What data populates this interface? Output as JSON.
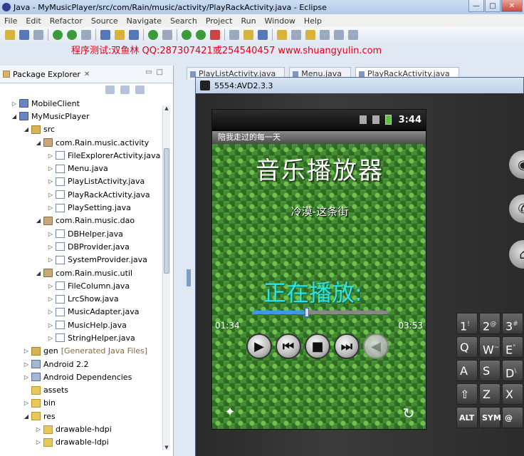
{
  "window": {
    "title": "Java - MyMusicPlayer/src/com/Rain/music/activity/PlayRackActivity.java - Eclipse",
    "min": "—",
    "max": "□",
    "close": "✕"
  },
  "menu": [
    "File",
    "Edit",
    "Refactor",
    "Source",
    "Navigate",
    "Search",
    "Project",
    "Run",
    "Window",
    "Help"
  ],
  "overlay_text": "程序测试:双鱼林 QQ:287307421或254540457 www.shuangyulin.com",
  "package_explorer": {
    "tab_label": "Package Explorer",
    "close": "✕",
    "tree": [
      {
        "label": "MobileClient",
        "level": 1,
        "icon": "project-icon",
        "twisty": "▷"
      },
      {
        "label": "MyMusicPlayer",
        "level": 1,
        "icon": "project-icon",
        "twisty": "◢"
      },
      {
        "label": "src",
        "level": 2,
        "icon": "source-folder-icon",
        "twisty": "◢"
      },
      {
        "label": "com.Rain.music.activity",
        "level": 3,
        "icon": "package-icon",
        "twisty": "◢"
      },
      {
        "label": "FileExplorerActivity.java",
        "level": 4,
        "icon": "java-file-icon",
        "twisty": "▷"
      },
      {
        "label": "Menu.java",
        "level": 4,
        "icon": "java-file-icon",
        "twisty": "▷"
      },
      {
        "label": "PlayListActivity.java",
        "level": 4,
        "icon": "java-file-icon",
        "twisty": "▷"
      },
      {
        "label": "PlayRackActivity.java",
        "level": 4,
        "icon": "java-file-icon",
        "twisty": "▷"
      },
      {
        "label": "PlaySetting.java",
        "level": 4,
        "icon": "java-file-icon",
        "twisty": "▷"
      },
      {
        "label": "com.Rain.music.dao",
        "level": 3,
        "icon": "package-icon",
        "twisty": "◢"
      },
      {
        "label": "DBHelper.java",
        "level": 4,
        "icon": "java-file-icon",
        "twisty": "▷"
      },
      {
        "label": "DBProvider.java",
        "level": 4,
        "icon": "java-file-icon",
        "twisty": "▷"
      },
      {
        "label": "SystemProvider.java",
        "level": 4,
        "icon": "java-file-icon",
        "twisty": "▷"
      },
      {
        "label": "com.Rain.music.util",
        "level": 3,
        "icon": "package-icon",
        "twisty": "◢"
      },
      {
        "label": "FileColumn.java",
        "level": 4,
        "icon": "java-file-icon",
        "twisty": "▷"
      },
      {
        "label": "LrcShow.java",
        "level": 4,
        "icon": "java-file-icon",
        "twisty": "▷"
      },
      {
        "label": "MusicAdapter.java",
        "level": 4,
        "icon": "java-file-icon",
        "twisty": "▷"
      },
      {
        "label": "MusicHelp.java",
        "level": 4,
        "icon": "java-file-icon",
        "twisty": "▷"
      },
      {
        "label": "StringHelper.java",
        "level": 4,
        "icon": "java-file-icon",
        "twisty": "▷"
      },
      {
        "label": "gen",
        "level": 2,
        "icon": "source-folder-icon",
        "twisty": "▷",
        "decoration": "[Generated Java Files]"
      },
      {
        "label": "Android 2.2",
        "level": 2,
        "icon": "library-icon",
        "twisty": "▷"
      },
      {
        "label": "Android Dependencies",
        "level": 2,
        "icon": "library-icon",
        "twisty": "▷"
      },
      {
        "label": "assets",
        "level": 2,
        "icon": "folder-icon",
        "twisty": ""
      },
      {
        "label": "bin",
        "level": 2,
        "icon": "folder-icon",
        "twisty": "▷"
      },
      {
        "label": "res",
        "level": 2,
        "icon": "folder-icon",
        "twisty": "◢"
      },
      {
        "label": "drawable-hdpi",
        "level": 3,
        "icon": "folder-icon",
        "twisty": "▷"
      },
      {
        "label": "drawable-ldpi",
        "level": 3,
        "icon": "folder-icon",
        "twisty": "▷"
      }
    ]
  },
  "editor_tabs": [
    "PlayListActivity.java",
    "Menu.java",
    "PlayRackActivity.java"
  ],
  "emulator": {
    "title": "5554:AVD2.3.3",
    "status_time": "3:44",
    "app": {
      "activity_title": "陪我走过的每一天",
      "heading": "音乐播放器",
      "song": "冷漠-这条街",
      "status": "正在播放:",
      "current_time": "01:34",
      "total_time": "03:53",
      "progress": 0.4,
      "controls": [
        {
          "name": "play-button",
          "glyph": "▶",
          "enabled": true
        },
        {
          "name": "previous-button",
          "glyph": "⏮",
          "enabled": true
        },
        {
          "name": "stop-button",
          "glyph": "■",
          "enabled": true
        },
        {
          "name": "next-button",
          "glyph": "⏭",
          "enabled": true
        },
        {
          "name": "volume-button",
          "glyph": "◀",
          "enabled": false
        }
      ]
    },
    "keyboard": {
      "row1": [
        "1",
        "2",
        "3"
      ],
      "row1_sup": [
        "!",
        "@",
        "#"
      ],
      "row2": [
        "Q",
        "W",
        "E"
      ],
      "row2_sup": [
        "",
        "~",
        "\""
      ],
      "row3": [
        "A",
        "S",
        "D"
      ],
      "row3_sup": [
        "",
        "",
        "\\"
      ],
      "row4": [
        "⇧",
        "Z",
        "X"
      ],
      "row5": [
        "ALT",
        "SYM",
        "@"
      ]
    }
  }
}
